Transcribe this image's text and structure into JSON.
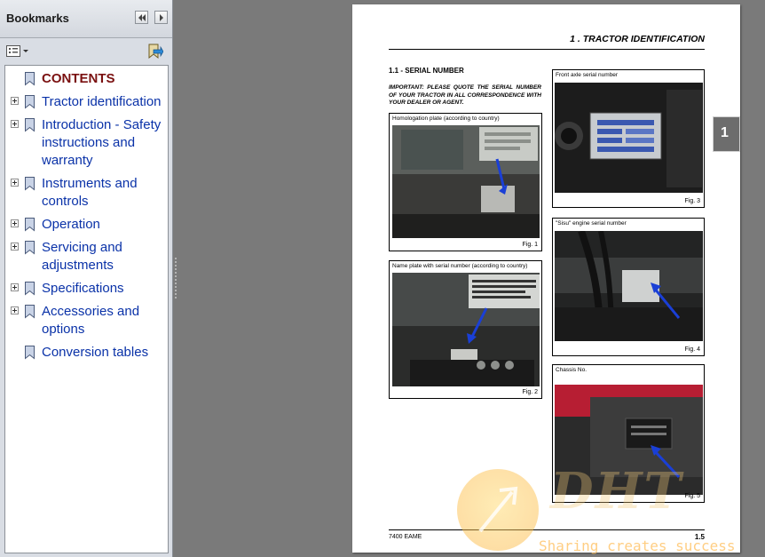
{
  "panel": {
    "title": "Bookmarks",
    "items": [
      {
        "label": "CONTENTS",
        "expandable": false
      },
      {
        "label": "Tractor identification",
        "expandable": true
      },
      {
        "label": "Introduction - Safety instructions and warranty",
        "expandable": true
      },
      {
        "label": "Instruments and controls",
        "expandable": true
      },
      {
        "label": "Operation",
        "expandable": true
      },
      {
        "label": "Servicing and adjustments",
        "expandable": true
      },
      {
        "label": "Specifications",
        "expandable": true
      },
      {
        "label": "Accessories and options",
        "expandable": true
      },
      {
        "label": "Conversion tables",
        "expandable": false
      }
    ]
  },
  "document": {
    "section_title": "1 . TRACTOR IDENTIFICATION",
    "serial_heading": "1.1 -  SERIAL NUMBER",
    "important_text": "IMPORTANT: PLEASE QUOTE THE SERIAL NUMBER OF YOUR TRACTOR IN ALL CORRESPONDENCE WITH YOUR DEALER OR AGENT.",
    "figures": [
      {
        "caption": "Homologation plate (according to country)",
        "number": "Fig. 1"
      },
      {
        "caption": "Name plate with serial number (according to country)",
        "number": "Fig. 2"
      },
      {
        "caption": "Front axle serial number",
        "number": "Fig. 3"
      },
      {
        "caption": "\"Sisu\" engine serial number",
        "number": "Fig. 4"
      },
      {
        "caption": "Chassis No.",
        "number": "Fig. 5"
      }
    ],
    "footer_left": "7400 EAME",
    "footer_right": "1.5"
  },
  "chapter_tab": "1",
  "watermark": {
    "letters": "DHT",
    "slogan": "Sharing creates success"
  },
  "colors": {
    "bookmark_link": "#0a32a8",
    "bookmark_current": "#7a1010",
    "arrow": "#1a3fd6",
    "background": "#7a7a7a"
  }
}
